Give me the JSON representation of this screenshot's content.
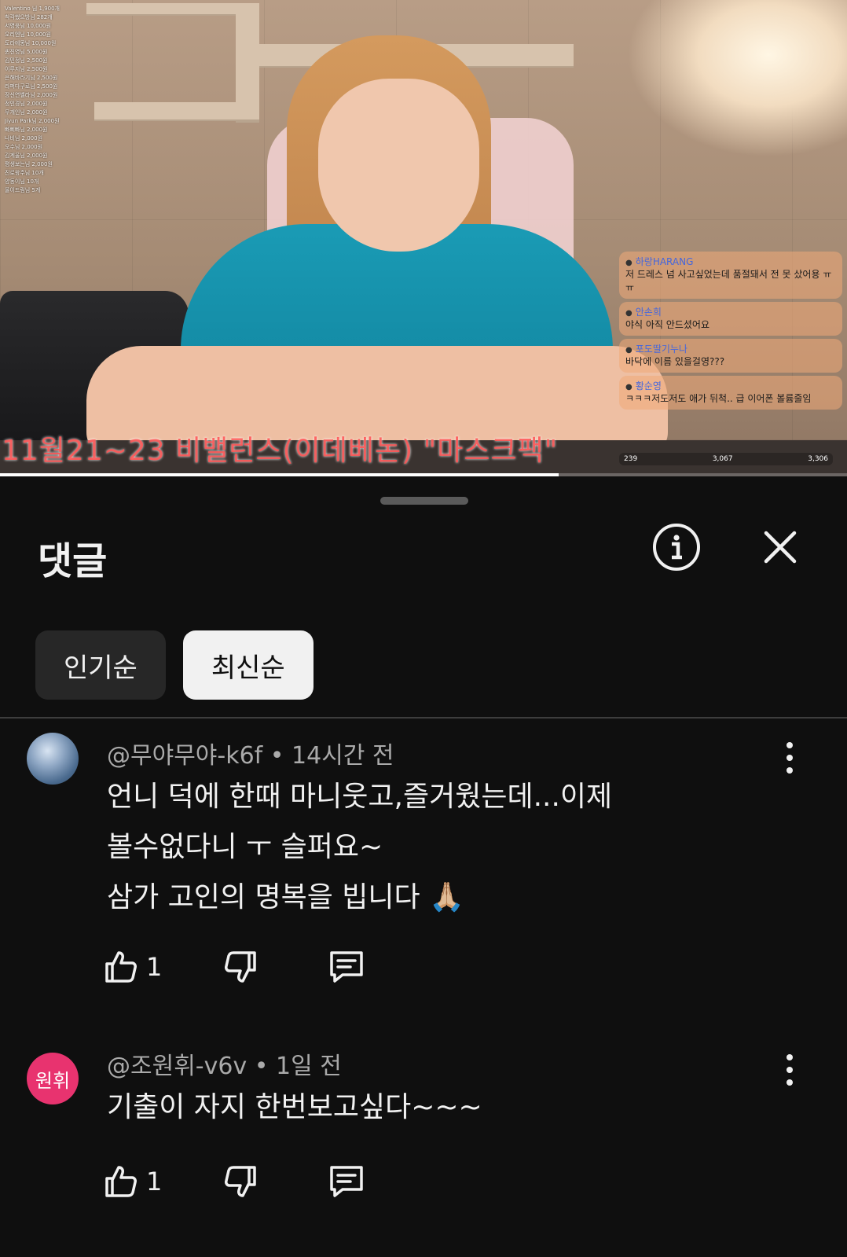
{
  "video": {
    "overlay_list": [
      "Valentino 님 1,900개",
      "착각했으방님 282개",
      "서영웅님 10,000원",
      "오리엔님 10,000원",
      "도라에몽님 10,000원",
      "퀸진영님 5,000원",
      "김민정님 2,500원",
      "이루지님 2,500원",
      "은해바라기님 2,500원",
      "라퍼다구로님 2,500원",
      "장신연벨라님 2,000원",
      "정인경님 2,000원",
      "무개인님 2,000원",
      "Jiyun Park님 2,000원",
      "빠삐빠님 2,000원",
      "나비님 2,000원",
      "오수님 2,000원",
      "김계울님 2,000원",
      "평생보는님 2,000원",
      "진로왕주님 10개",
      "양동이님 10개",
      "올이드림님 5개"
    ],
    "ticker": "11월21~23  비밸런스(이데베논)  \"마스크팩\"",
    "chat": [
      {
        "name": "하랑HARANG",
        "text": "저 드레스 넘 사고싶었는데 품절돼서 전 못 샀어용 ㅠㅠ"
      },
      {
        "name": "안손희",
        "text": "야식 아직 안드셨어요"
      },
      {
        "name": "포도딸기누나",
        "text": "바닥에 이름 있을걸영???"
      },
      {
        "name": "황순영",
        "text": "ㅋㅋㅋ저도저도 애가 뒤척.. 급 이어폰 볼륨줄임"
      }
    ],
    "stats": {
      "viewers": "239",
      "likes": "3,067",
      "fans": "3,306"
    },
    "progress": 0.66
  },
  "sheet": {
    "title": "댓글",
    "info_icon": "info-icon",
    "close_icon": "close-icon",
    "sort_tabs": [
      {
        "label": "인기순",
        "selected": false
      },
      {
        "label": "최신순",
        "selected": true
      }
    ]
  },
  "comments": [
    {
      "avatar_text": "",
      "meta": "@무야무야-k6f • 14시간 전",
      "lines": [
        "언니 덕에 한때 마니웃고,즐거웠는데...이제",
        "볼수없다니 ㅜ 슬퍼요~",
        "삼가 고인의 명복을 빕니다 🙏🏼"
      ],
      "likes": "1"
    },
    {
      "avatar_text": "원휘",
      "meta": "@조원휘-v6v • 1일 전",
      "lines": [
        "기출이 자지 한번보고싶다~~~"
      ],
      "likes": "1"
    }
  ],
  "colors": {
    "background": "#0f0f0f",
    "text": "#f1f1f1",
    "muted": "#aaaaaa",
    "avatar_pink": "#e8336f"
  }
}
